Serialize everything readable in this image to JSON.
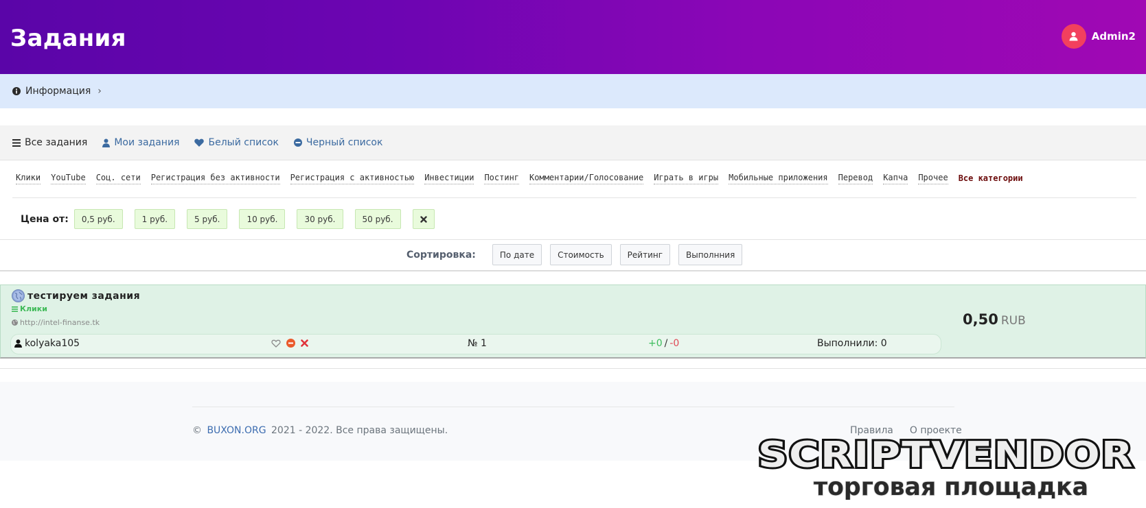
{
  "header": {
    "title": "Задания",
    "username": "Admin2",
    "colors": {
      "gradient_start": "#5a05a8",
      "gradient_end": "#a008b4",
      "avatar": "#f2405e"
    }
  },
  "infobar": {
    "label": "Информация",
    "icon": "info-circle-icon"
  },
  "tabs": [
    {
      "label": "Все задания",
      "icon": "list-icon",
      "active": true
    },
    {
      "label": "Мои задания",
      "icon": "user-icon",
      "active": false
    },
    {
      "label": "Белый список",
      "icon": "heart-icon",
      "active": false
    },
    {
      "label": "Черный список",
      "icon": "minus-circle-icon",
      "active": false
    }
  ],
  "categories": [
    "Клики",
    "YouTube",
    "Соц. сети",
    "Регистрация без активности",
    "Регистрация с активностью",
    "Инвестиции",
    "Постинг",
    "Комментарии/Голосование",
    "Играть в игры",
    "Мобильные приложения",
    "Перевод",
    "Капча",
    "Прочее"
  ],
  "categories_all": "Все категории",
  "price_filter": {
    "label": "Цена от:",
    "options": [
      "0,5 руб.",
      "1 руб.",
      "5 руб.",
      "10 руб.",
      "30 руб.",
      "50 руб."
    ],
    "clear_icon": "close-icon"
  },
  "sort": {
    "label": "Сортировка:",
    "options": [
      "По дате",
      "Стоимость",
      "Рейтинг",
      "Выполнния"
    ]
  },
  "task": {
    "title": "тестируем задания",
    "category": "Клики",
    "url": "http://intel-finanse.tk",
    "price": "0,50",
    "currency": "RUB",
    "author": "kolyaka105",
    "number": "№ 1",
    "votes_plus": "+0",
    "votes_minus": "-0",
    "completed": "Выполнили: 0",
    "colors": {
      "card_bg": "#dff2e6",
      "category": "#3fba58"
    }
  },
  "footer": {
    "copyright_symbol": "©",
    "brand": "BUXON.ORG",
    "copyright_text": "2021 - 2022. Все права защищены.",
    "links": [
      "Правила",
      "О проекте"
    ]
  },
  "watermark": {
    "line1": "SCRIPTVENDOR",
    "line2": "торговая площадка"
  }
}
